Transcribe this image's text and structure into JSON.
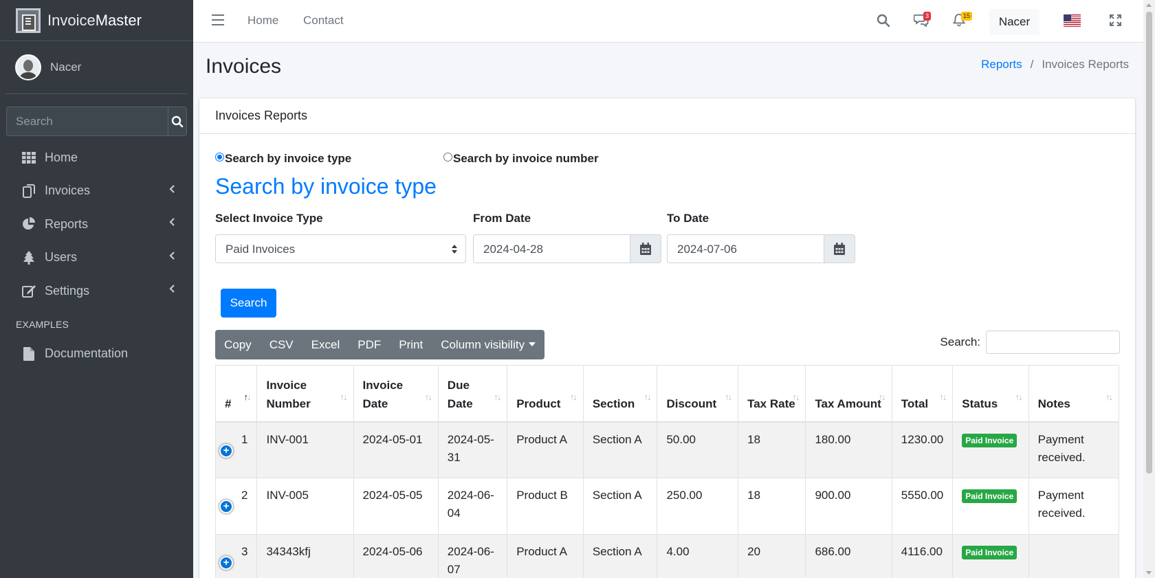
{
  "brand": {
    "bold": "Invoice",
    "rest": "Master"
  },
  "user": {
    "name": "Nacer"
  },
  "sidebar": {
    "search_placeholder": "Search",
    "items": [
      {
        "label": "Home",
        "icon": "th-icon"
      },
      {
        "label": "Invoices",
        "icon": "copy-icon"
      },
      {
        "label": "Reports",
        "icon": "chart-pie-icon"
      },
      {
        "label": "Users",
        "icon": "tree-icon"
      },
      {
        "label": "Settings",
        "icon": "edit-icon"
      }
    ],
    "header": "EXAMPLES",
    "doc_label": "Documentation"
  },
  "topbar": {
    "home": "Home",
    "contact": "Contact",
    "messages_count": "3",
    "notifications_count": "15",
    "user": "Nacer"
  },
  "page": {
    "title": "Invoices",
    "breadcrumb": {
      "parent": "Reports",
      "sep": "/",
      "current": "Invoices Reports"
    }
  },
  "card": {
    "header": "Invoices Reports",
    "radio_type": "Search by invoice type",
    "radio_number": "Search by invoice number",
    "section_heading": "Search by invoice type",
    "label_type": "Select Invoice Type",
    "label_from": "From Date",
    "label_to": "To Date",
    "type_value": "Paid Invoices",
    "from_value": "2024-04-28",
    "to_value": "2024-07-06",
    "search_button": "Search",
    "export_buttons": [
      "Copy",
      "CSV",
      "Excel",
      "PDF",
      "Print",
      "Column visibility"
    ],
    "table_search_label": "Search:"
  },
  "table": {
    "headers": [
      "#",
      "Invoice Number",
      "Invoice Date",
      "Due Date",
      "Product",
      "Section",
      "Discount",
      "Tax Rate",
      "Tax Amount",
      "Total",
      "Status",
      "Notes"
    ],
    "rows": [
      [
        "1",
        "INV-001",
        "2024-05-01",
        "2024-05-31",
        "Product A",
        "Section A",
        "50.00",
        "18",
        "180.00",
        "1230.00",
        "Paid Invoice",
        "Payment received."
      ],
      [
        "2",
        "INV-005",
        "2024-05-05",
        "2024-06-04",
        "Product B",
        "Section A",
        "250.00",
        "18",
        "900.00",
        "5550.00",
        "Paid Invoice",
        "Payment received."
      ],
      [
        "3",
        "34343kfj",
        "2024-05-06",
        "2024-06-07",
        "Product A",
        "Section A",
        "4.00",
        "20",
        "686.00",
        "4116.00",
        "Paid Invoice",
        ""
      ]
    ]
  },
  "colors": {
    "primary": "#007bff",
    "sidebar": "#343a40",
    "success": "#28a745",
    "danger": "#dc3545",
    "warning": "#ffc107"
  }
}
